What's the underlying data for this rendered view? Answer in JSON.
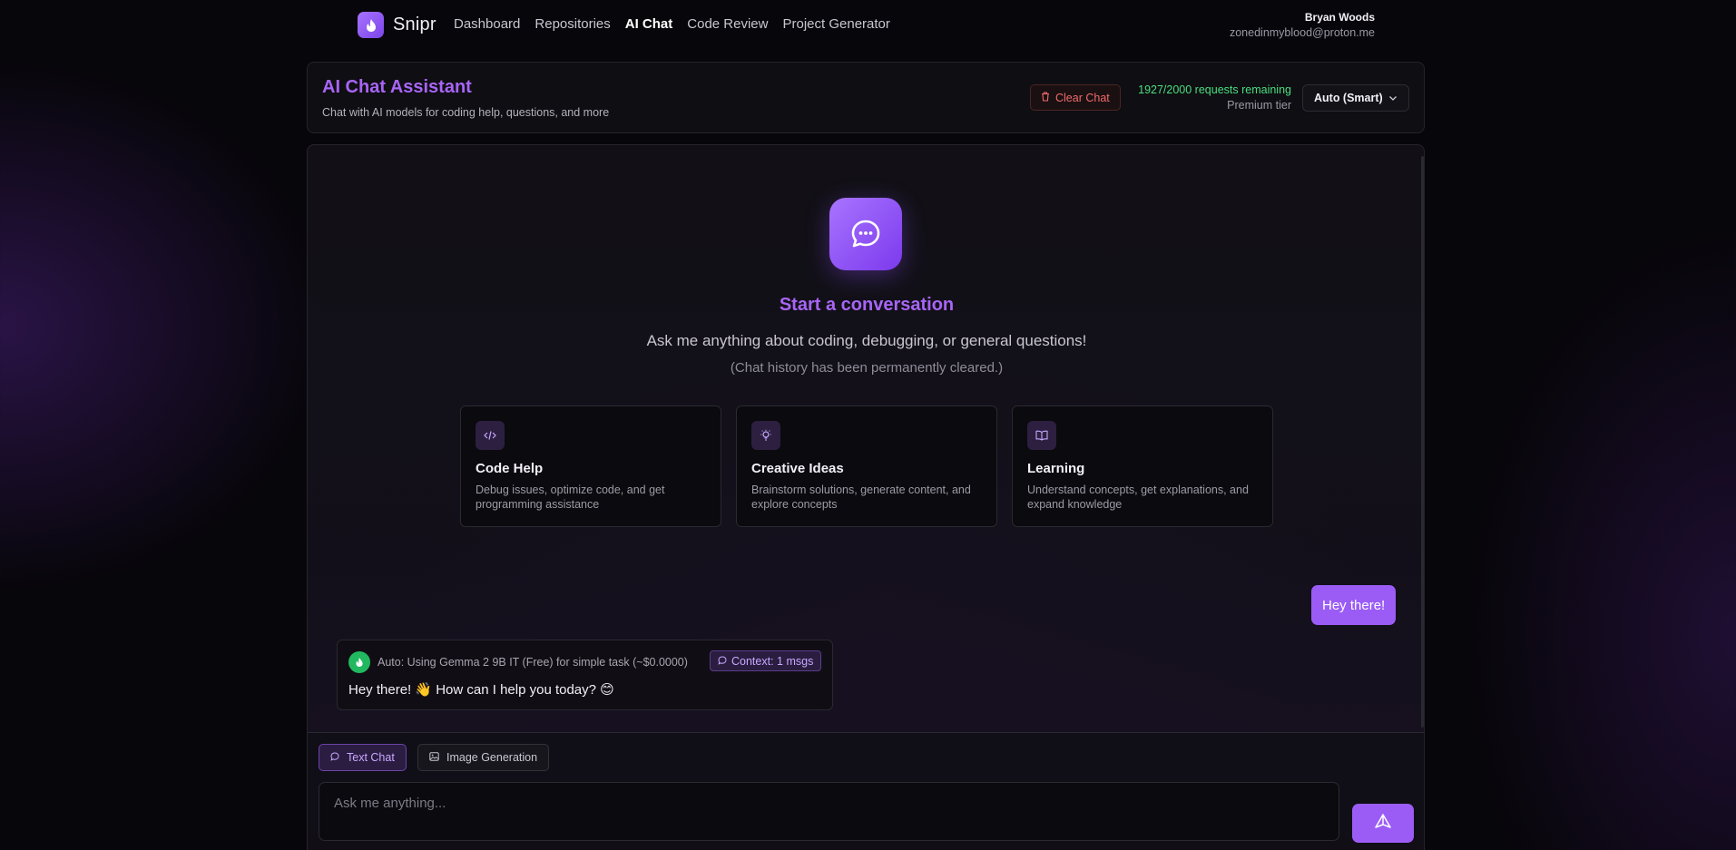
{
  "app": {
    "name": "Snipr",
    "logo_icon": "flame-icon",
    "accent": "#a865f7"
  },
  "nav": {
    "links": [
      {
        "label": "Dashboard",
        "active": false
      },
      {
        "label": "Repositories",
        "active": false
      },
      {
        "label": "AI Chat",
        "active": true
      },
      {
        "label": "Code Review",
        "active": false
      },
      {
        "label": "Project Generator",
        "active": false
      }
    ]
  },
  "user": {
    "name": "Bryan Woods",
    "email": "zonedinmyblood@proton.me"
  },
  "header": {
    "title": "AI Chat Assistant",
    "subtitle": "Chat with AI models for coding help, questions, and more",
    "clear_label": "Clear Chat",
    "quota": "1927/2000 requests remaining",
    "tier": "Premium tier",
    "model": "Auto (Smart)"
  },
  "empty_state": {
    "title": "Start a conversation",
    "subtitle": "Ask me anything about coding, debugging, or general questions!",
    "note": "(Chat history has been permanently cleared.)",
    "cards": [
      {
        "icon": "code-icon",
        "title": "Code Help",
        "desc_line1": "Debug issues, optimize code, and get",
        "desc_line2": "programming assistance"
      },
      {
        "icon": "lightbulb-icon",
        "title": "Creative Ideas",
        "desc_line1": "Brainstorm solutions, generate content, and",
        "desc_line2": "explore concepts"
      },
      {
        "icon": "book-icon",
        "title": "Learning",
        "desc_line1": "Understand concepts, get explanations, and",
        "desc_line2": "expand knowledge"
      }
    ]
  },
  "messages": {
    "user": "Hey there!",
    "ai_meta": "Auto: Using Gemma 2 9B IT (Free) for simple task (~$0.0000)",
    "ai_context": "Context: 1 msgs",
    "ai_text": "Hey there! 👋 How can I help you today? 😊"
  },
  "composer": {
    "tab_text": "Text Chat",
    "tab_image": "Image Generation",
    "placeholder": "Ask me anything..."
  }
}
